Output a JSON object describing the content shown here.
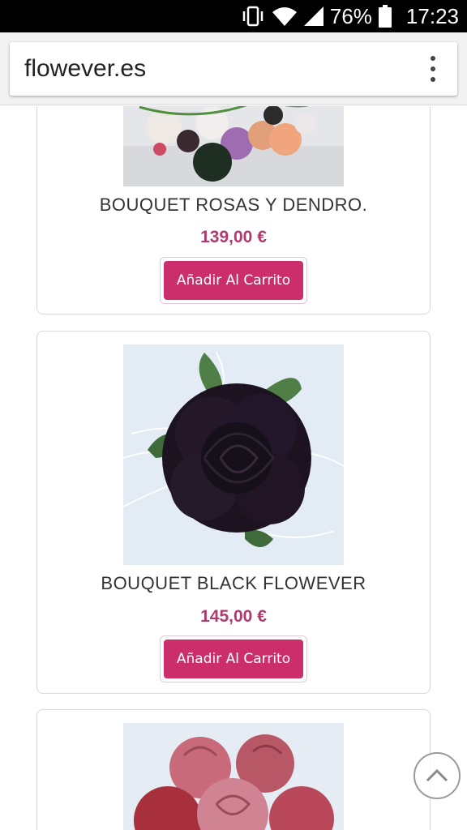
{
  "status_bar": {
    "battery_percent": "76%",
    "time": "17:23",
    "icons": [
      "vibrate-icon",
      "wifi-icon",
      "signal-icon",
      "battery-icon"
    ]
  },
  "browser": {
    "url": "flowever.es",
    "menu_icon": "overflow-menu-icon"
  },
  "products": [
    {
      "title": "BOUQUET ROSAS Y DENDRO.",
      "price": "139,00 €",
      "button": "Añadir Al Carrito"
    },
    {
      "title": "BOUQUET BLACK FLOWEVER",
      "price": "145,00 €",
      "button": "Añadir Al Carrito"
    },
    {
      "title": "",
      "price": "",
      "button": ""
    }
  ],
  "scroll_top_icon": "chevron-up-icon",
  "colors": {
    "accent": "#cc2e6c",
    "price": "#b03a6e",
    "card_border": "#d9d9d9"
  }
}
